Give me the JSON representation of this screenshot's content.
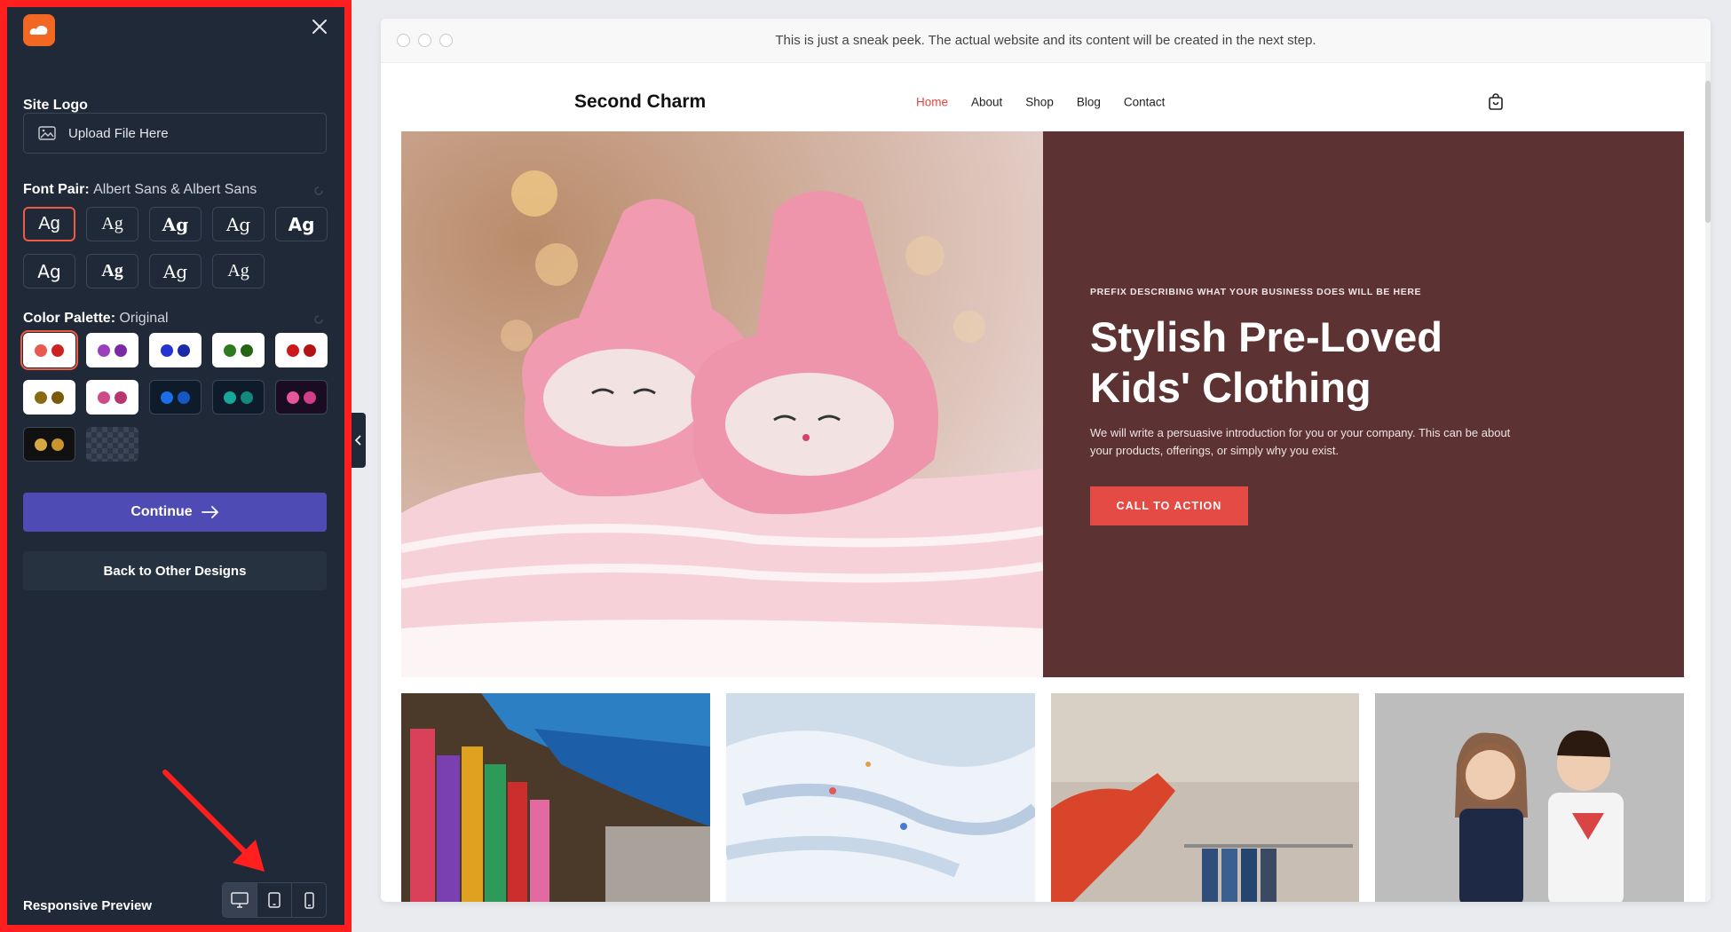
{
  "sidebar": {
    "site_logo_label": "Site Logo",
    "upload_label": "Upload File Here",
    "font_pair_label": "Font Pair:",
    "font_pair_value": "Albert Sans & Albert Sans",
    "font_sample": "Ag",
    "color_palette_label": "Color Palette:",
    "color_palette_value": "Original",
    "palettes": [
      {
        "bg": "#ffffff",
        "c1": "#e85a50",
        "c2": "#cc2222"
      },
      {
        "bg": "#ffffff",
        "c1": "#9b3fbf",
        "c2": "#7a2aa8"
      },
      {
        "bg": "#ffffff",
        "c1": "#2434d0",
        "c2": "#1b2aa8"
      },
      {
        "bg": "#ffffff",
        "c1": "#2e7a1f",
        "c2": "#276515"
      },
      {
        "bg": "#ffffff",
        "c1": "#cc1a1a",
        "c2": "#b21414"
      },
      {
        "bg": "#ffffff",
        "c1": "#8a6a10",
        "c2": "#7a5a05"
      },
      {
        "bg": "#ffffff",
        "c1": "#d04a8a",
        "c2": "#b8356f"
      },
      {
        "bg": "#0d1b2a",
        "c1": "#1a6ee8",
        "c2": "#1558c4"
      },
      {
        "bg": "#0d1b2a",
        "c1": "#17a89a",
        "c2": "#11897d"
      },
      {
        "bg": "#1a0d22",
        "c1": "#e8559f",
        "c2": "#d13d88"
      },
      {
        "bg": "#111111",
        "c1": "#d8a940",
        "c2": "#c89430"
      },
      {
        "bg": "checker",
        "c1": "",
        "c2": ""
      }
    ],
    "continue_label": "Continue",
    "back_label": "Back to Other Designs",
    "responsive_label": "Responsive Preview"
  },
  "preview": {
    "notice": "This is just a sneak peek. The actual website and its content will be created in the next step.",
    "brand": "Second Charm",
    "nav": [
      "Home",
      "About",
      "Shop",
      "Blog",
      "Contact"
    ],
    "hero": {
      "prefix": "PREFIX DESCRIBING WHAT YOUR BUSINESS DOES WILL BE HERE",
      "title": "Stylish Pre-Loved Kids' Clothing",
      "description": "We will write a persuasive introduction for you or your company. This can be about your products, offerings, or simply why you exist.",
      "cta": "CALL TO ACTION"
    }
  },
  "colors": {
    "sidebar_bg": "#1f2937",
    "highlight_border": "#ff1f1f",
    "continue_bg": "#4f4bb5",
    "hero_bg": "#5c3232",
    "cta_bg": "#e54b45",
    "nav_active": "#e0483e"
  }
}
